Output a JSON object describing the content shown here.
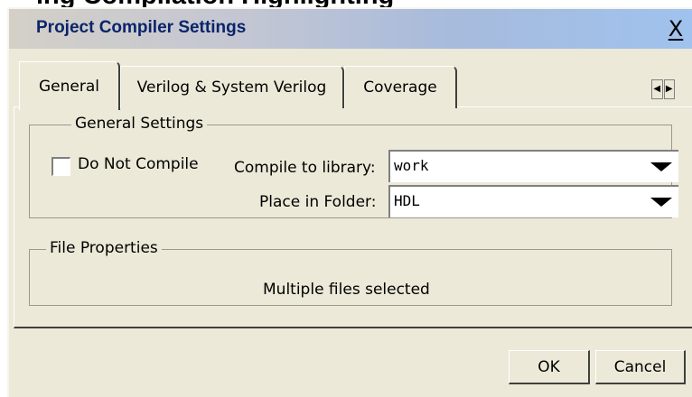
{
  "background_heading": "ing Compilation Highlighting",
  "dialog": {
    "title": "Project Compiler Settings",
    "close_glyph": "X"
  },
  "tabs": [
    {
      "label": "General",
      "active": true
    },
    {
      "label": "Verilog & System Verilog",
      "active": false
    },
    {
      "label": "Coverage",
      "active": false
    }
  ],
  "tab_scroll": {
    "left_glyph": "◀",
    "right_glyph": "▶"
  },
  "general_settings": {
    "legend": "General Settings",
    "do_not_compile": {
      "label": "Do Not Compile",
      "checked": false
    },
    "compile_to_library": {
      "label": "Compile to library:",
      "value": "work"
    },
    "place_in_folder": {
      "label": "Place in Folder:",
      "value": "HDL"
    }
  },
  "file_properties": {
    "legend": "File Properties",
    "text": "Multiple files selected"
  },
  "buttons": {
    "ok": "OK",
    "cancel": "Cancel"
  },
  "colors": {
    "dialog_bg": "#ece9d8",
    "title_text": "#0a246a",
    "title_gradient_end": "#9fc2ee"
  }
}
